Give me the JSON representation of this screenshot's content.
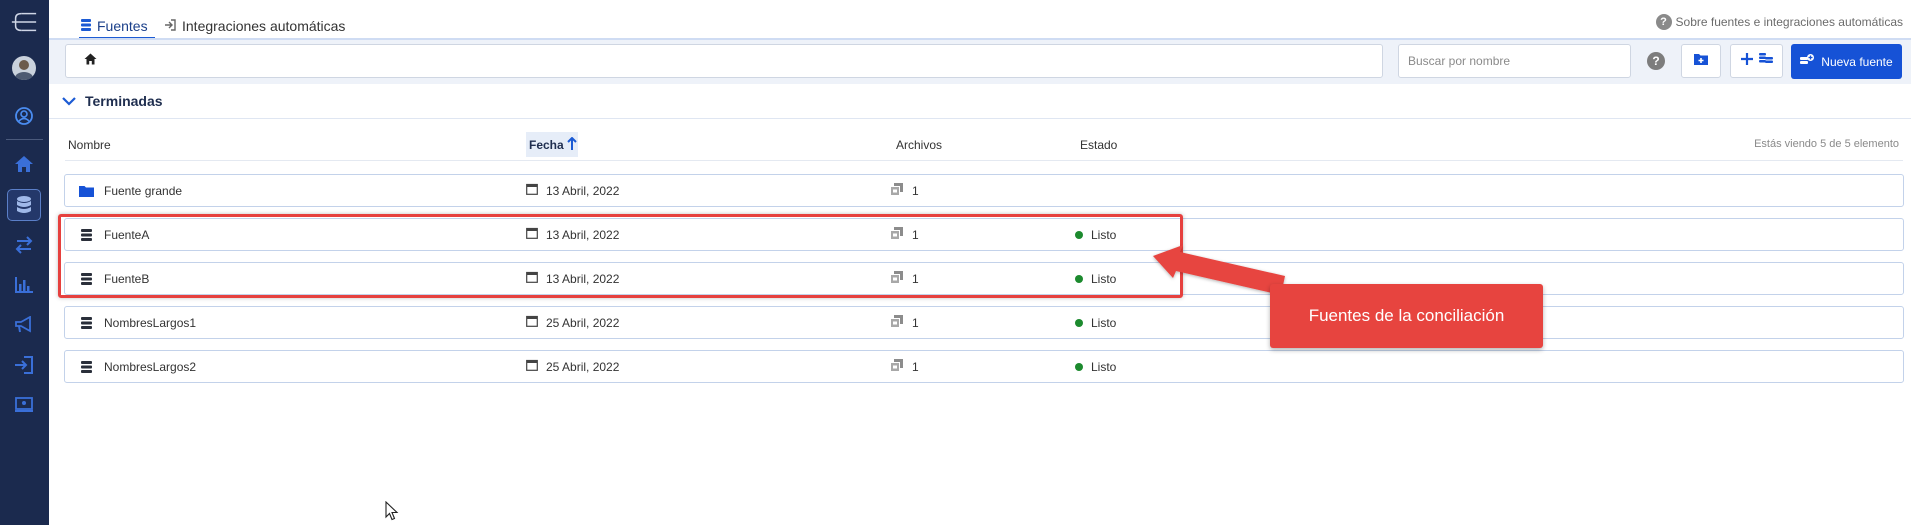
{
  "tabs": [
    {
      "label": "Fuentes",
      "active": true
    },
    {
      "label": "Integraciones automáticas",
      "active": false
    }
  ],
  "help_link": "Sobre fuentes e integraciones automáticas",
  "toolbar": {
    "search_placeholder": "Buscar por nombre",
    "new_source_label": "Nueva fuente"
  },
  "section": {
    "title": "Terminadas"
  },
  "table": {
    "headers": {
      "name": "Nombre",
      "date": "Fecha",
      "files": "Archivos",
      "state": "Estado"
    },
    "count_text": "Estás viendo 5 de 5 elemento",
    "rows": [
      {
        "icon": "folder-icon",
        "name": "Fuente grande",
        "date": "13 Abril, 2022",
        "files": "1",
        "state": ""
      },
      {
        "icon": "database-icon",
        "name": "FuenteA",
        "date": "13 Abril, 2022",
        "files": "1",
        "state": "Listo"
      },
      {
        "icon": "database-icon",
        "name": "FuenteB",
        "date": "13 Abril, 2022",
        "files": "1",
        "state": "Listo"
      },
      {
        "icon": "database-icon",
        "name": "NombresLargos1",
        "date": "25 Abril, 2022",
        "files": "1",
        "state": "Listo"
      },
      {
        "icon": "database-icon",
        "name": "NombresLargos2",
        "date": "25 Abril, 2022",
        "files": "1",
        "state": "Listo"
      }
    ]
  },
  "annotation": {
    "label": "Fuentes de la conciliación"
  },
  "colors": {
    "sidebar": "#1b2a4e",
    "accent": "#1652d6",
    "annotation": "#e7443f",
    "status_ok": "#1c8a2e"
  },
  "sidebar_icons": [
    "menu-icon",
    "avatar",
    "user-circle-icon",
    "home-icon",
    "database-icon",
    "transfer-icon",
    "bar-chart-icon",
    "megaphone-icon",
    "login-icon",
    "monitor-icon"
  ]
}
